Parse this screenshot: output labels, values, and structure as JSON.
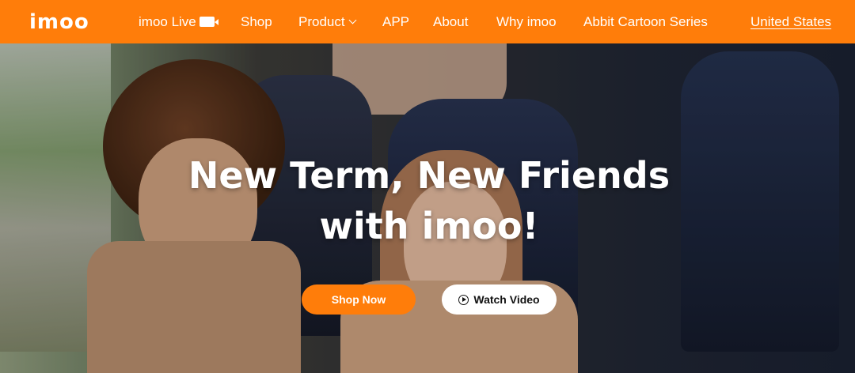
{
  "nav": {
    "logo": "imoo",
    "items": [
      {
        "label": "imoo Live"
      },
      {
        "label": "Shop"
      },
      {
        "label": "Product"
      },
      {
        "label": "APP"
      },
      {
        "label": "About"
      },
      {
        "label": "Why imoo"
      },
      {
        "label": "Abbit Cartoon Series"
      }
    ],
    "region": "United States",
    "icons": {
      "live": "video-camera-icon",
      "product_dropdown": "chevron-down-icon"
    }
  },
  "hero": {
    "headline_line1": "New Term, New Friends",
    "headline_line2": "with imoo!",
    "shop_button": "Shop Now",
    "video_button": "Watch Video"
  },
  "colors": {
    "brand": "#ff7d0a",
    "text_on_brand": "#ffffff"
  }
}
